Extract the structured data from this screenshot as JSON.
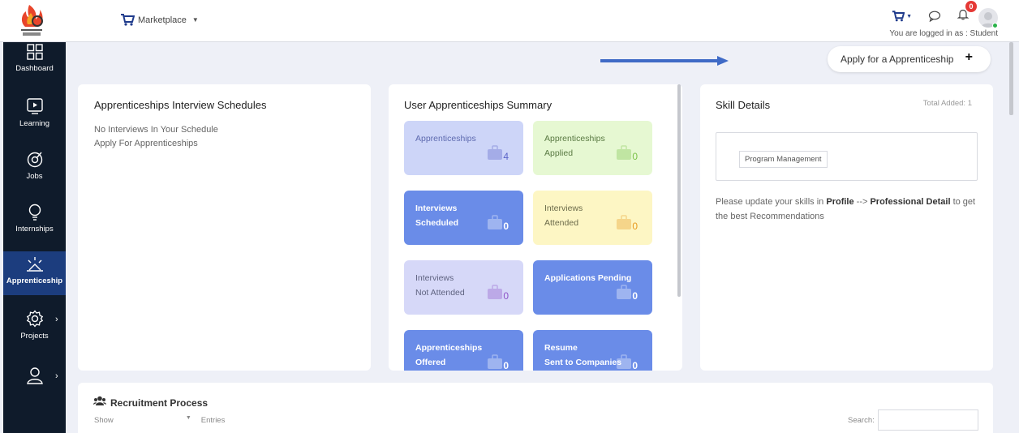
{
  "topbar": {
    "marketplace_label": "Marketplace",
    "notification_count": "0",
    "logged_in_text": "You are logged in as : Student"
  },
  "sidebar": {
    "items": [
      {
        "label": "Dashboard",
        "icon": "grid-icon"
      },
      {
        "label": "Learning",
        "icon": "monitor-play-icon"
      },
      {
        "label": "Jobs",
        "icon": "target-icon"
      },
      {
        "label": "Internships",
        "icon": "lightbulb-icon"
      },
      {
        "label": "Apprenticeship",
        "icon": "sunrise-icon",
        "active": true
      },
      {
        "label": "Projects",
        "icon": "gear-icon",
        "has_submenu": true
      },
      {
        "label": "",
        "icon": "user-icon",
        "has_submenu": true
      }
    ]
  },
  "apply_button": {
    "label": "Apply for a Apprenticeship"
  },
  "interview_card": {
    "title": "Apprenticeships Interview Schedules",
    "line1": "No Interviews In Your Schedule",
    "line2": "Apply For Apprenticeships"
  },
  "summary_card": {
    "title": "User Apprenticeships Summary",
    "tiles": [
      {
        "line1": "Apprenticeships",
        "line2": "",
        "count": "4",
        "bg": "#cdd5f8",
        "fg": "#5f6bb0",
        "cntfg": "#5a63c8"
      },
      {
        "line1": "Apprenticeships",
        "line2": "Applied",
        "count": "0",
        "bg": "#e6f8d2",
        "fg": "#5a7a43",
        "cntfg": "#7cc24a"
      },
      {
        "line1": "Interviews",
        "line2": "Scheduled",
        "count": "0",
        "bg": "#6a8ce8",
        "fg": "#ffffff",
        "cntfg": "#ffffff"
      },
      {
        "line1": "Interviews",
        "line2": "Attended",
        "count": "0",
        "bg": "#fdf6c4",
        "fg": "#6b6a4a",
        "cntfg": "#e89a20"
      },
      {
        "line1": "Interviews",
        "line2": "Not Attended",
        "count": "0",
        "bg": "#d6d8f8",
        "fg": "#5f6380",
        "cntfg": "#8e55c8"
      },
      {
        "line1": "Applications Pending",
        "line2": "",
        "count": "0",
        "bg": "#6a8ce8",
        "fg": "#ffffff",
        "cntfg": "#ffffff"
      },
      {
        "line1": "Apprenticeships",
        "line2": "Offered",
        "count": "0",
        "bg": "#6a8ce8",
        "fg": "#ffffff",
        "cntfg": "#ffffff"
      },
      {
        "line1": "Resume",
        "line2": "Sent to Companies",
        "count": "0",
        "bg": "#6a8ce8",
        "fg": "#ffffff",
        "cntfg": "#ffffff"
      }
    ]
  },
  "skill_card": {
    "title": "Skill Details",
    "total": "Total Added: 1",
    "skills": [
      "Program Management"
    ],
    "note_pre": "Please update your skills in ",
    "note_profile": "Profile",
    "note_mid": " --> ",
    "note_detail": "Professional Detail",
    "note_post": " to get the best Recommendations"
  },
  "recruitment": {
    "title": "Recruitment Process",
    "show_label": "Show",
    "entries_label": "Entries",
    "search_label": "Search:"
  },
  "colors": {
    "sidebar_bg": "#0f1b2b",
    "sidebar_active": "#1c3d7e",
    "accent_blue": "#3f6ac6",
    "badge_red": "#e53935"
  }
}
